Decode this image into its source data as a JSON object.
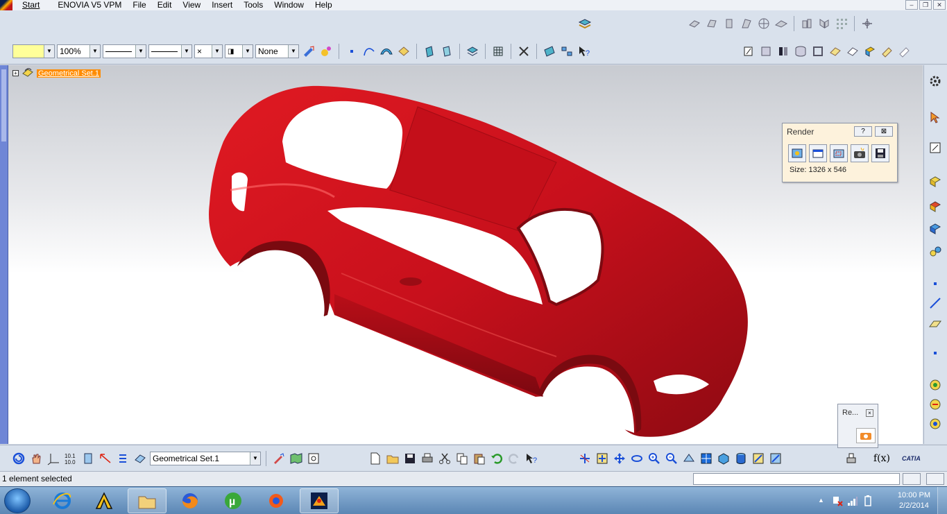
{
  "menu": {
    "start": "Start",
    "items": [
      "ENOVIA V5 VPM",
      "File",
      "Edit",
      "View",
      "Insert",
      "Tools",
      "Window",
      "Help"
    ]
  },
  "toolbar": {
    "zoom_value": "100%",
    "layer_value": "None",
    "point_style": "×"
  },
  "tree": {
    "root_label": "Geometrical Set.1"
  },
  "render_dialog": {
    "title": "Render",
    "help_label": "?",
    "close_label": "⊠",
    "size_text": "Size: 1326 x 546"
  },
  "mini_render": {
    "title": "Re...",
    "close_label": "×"
  },
  "bottom_toolbar": {
    "current_set": "Geometrical Set.1",
    "formula_label": "f(x)",
    "brand_label": "CATIA"
  },
  "status": {
    "text": "1 element selected"
  },
  "taskbar": {
    "time": "10:00 PM",
    "date": "2/2/2014"
  },
  "colors": {
    "car_body": "#c8101c",
    "tree_highlight": "#ff8c00",
    "viewport_bg": "#ffffff"
  }
}
